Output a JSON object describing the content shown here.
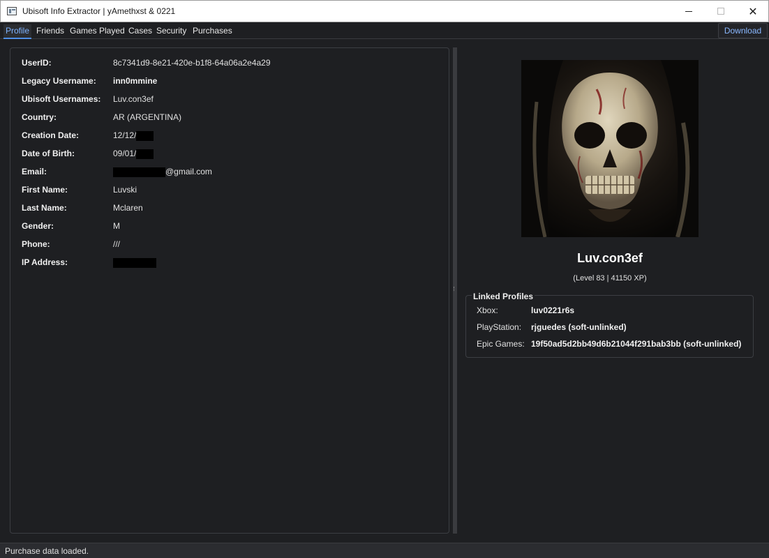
{
  "window": {
    "title": "Ubisoft Info Extractor | yAmethxst & 0221"
  },
  "tabs": [
    {
      "label": "Profile"
    },
    {
      "label": "Friends"
    },
    {
      "label": "Games Played"
    },
    {
      "label": "Cases"
    },
    {
      "label": "Security"
    },
    {
      "label": "Purchases"
    }
  ],
  "toolbar": {
    "download_label": "Download"
  },
  "profile_fields": [
    {
      "label": "UserID:",
      "value": "8c7341d9-8e21-420e-b1f8-64a06a2e4a29"
    },
    {
      "label": "Legacy Username:",
      "value": "inn0mmine"
    },
    {
      "label": "Ubisoft Usernames:",
      "value": "Luv.con3ef"
    },
    {
      "label": "Country:",
      "value": "AR (ARGENTINA)"
    },
    {
      "label": "Creation Date:",
      "value": "12/12/"
    },
    {
      "label": "Date of Birth:",
      "value": "09/01/"
    },
    {
      "label": "Email:",
      "value": "@gmail.com"
    },
    {
      "label": "First Name:",
      "value": "Luvski"
    },
    {
      "label": "Last Name:",
      "value": "Mclaren"
    },
    {
      "label": "Gender:",
      "value": "M"
    },
    {
      "label": "Phone:",
      "value": "///"
    },
    {
      "label": "IP Address:",
      "value": ""
    }
  ],
  "profile_card": {
    "display_name": "Luv.con3ef",
    "level_text": "(Level 83 | 41150 XP)"
  },
  "linked_profiles": {
    "title": "Linked Profiles",
    "items": [
      {
        "label": "Xbox:",
        "value": "luv0221r6s"
      },
      {
        "label": "PlayStation:",
        "value": "rjguedes (soft-unlinked)"
      },
      {
        "label": "Epic Games:",
        "value": "19f50ad5d2bb49d6b21044f291bab3bb (soft-unlinked)"
      }
    ]
  },
  "status": {
    "text": "Purchase data loaded."
  },
  "colors": {
    "accent": "#4f8fe6",
    "background": "#1e1f22",
    "redaction": "#000000"
  }
}
